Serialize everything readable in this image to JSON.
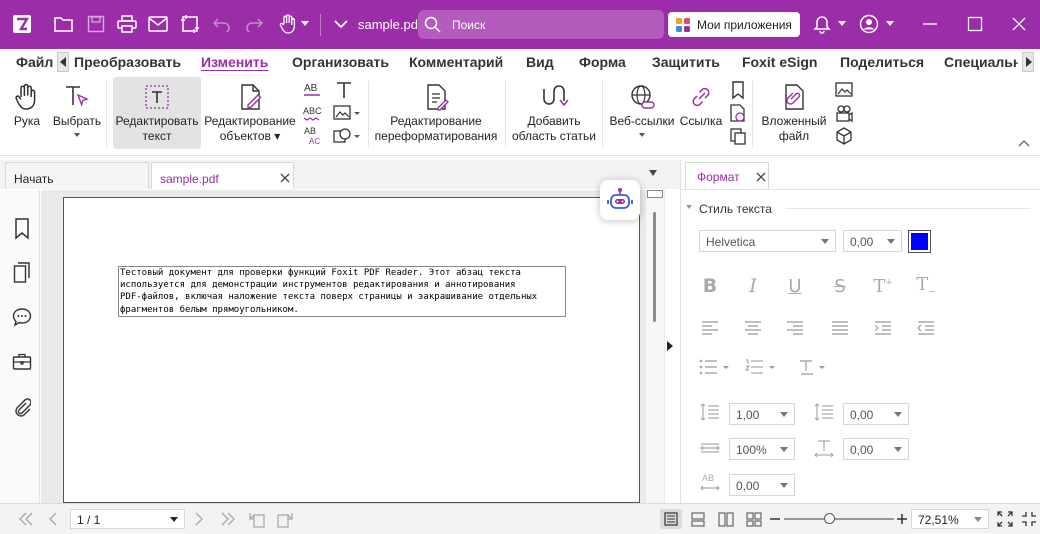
{
  "titlebar": {
    "file_name": "sample.pdf",
    "search_placeholder": "Поиск",
    "apps_label": "Мои приложения",
    "bg_color": "#9b2da8"
  },
  "menu": {
    "items": [
      "Файл",
      "Преобразовать",
      "Изменить",
      "Организовать",
      "Комментарий",
      "Вид",
      "Форма",
      "Защитить",
      "Foxit eSign",
      "Поделиться",
      "Специальны"
    ],
    "active": "Изменить"
  },
  "ribbon": {
    "hand": "Рука",
    "select": "Выбрать",
    "edit_text_1": "Редактировать",
    "edit_text_2": "текст",
    "edit_objects_1": "Редактирование",
    "edit_objects_2": "объектов",
    "reflow_1": "Редактирование",
    "reflow_2": "переформатирования",
    "add_area_1": "Добавить",
    "add_area_2": "область статьи",
    "weblinks": "Веб-ссылки",
    "link": "Ссылка",
    "attach_1": "Вложенный",
    "attach_2": "файл",
    "ab_glyph": "AB",
    "abc_glyph": "ABC",
    "abac_glyph": "AB"
  },
  "tabs": {
    "start": "Начать",
    "doc": "sample.pdf"
  },
  "document": {
    "lines": [
      "Тестовый документ для проверки функций Foxit PDF Reader. Этот абзац текста",
      "используется для демонстрации инструментов редактирования и аннотирования",
      "PDF-файлов, включая наложение текста поверх страницы и закрашивание отдельных",
      "фрагментов белым прямоугольником."
    ]
  },
  "format_panel": {
    "tab": "Формат",
    "section": "Стиль текста",
    "font": "Helvetica",
    "font_size": "0,00",
    "color": "#0000ff",
    "line_spacing": "1,00",
    "para_spacing": "0,00",
    "scale": "100%",
    "char_spacing": "0,00",
    "word_spacing": "0,00"
  },
  "statusbar": {
    "page": "1 / 1",
    "zoom": "72,51%",
    "zoom_level": 0.4
  }
}
